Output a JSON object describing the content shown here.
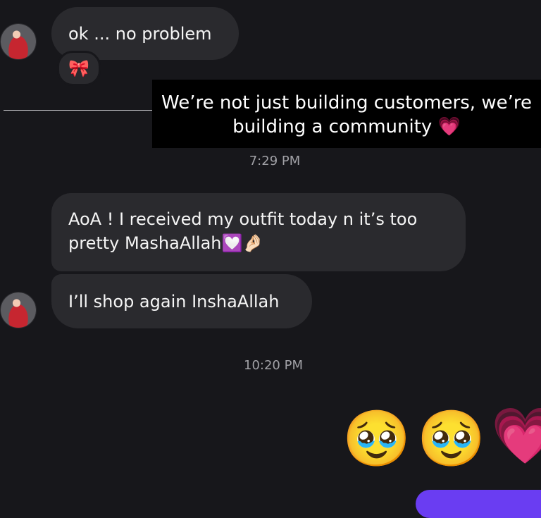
{
  "messages": {
    "first": "ok ... no problem",
    "first_reaction": "🎀",
    "story_text": "We’re not just building customers, we’re building a community 💗",
    "time_1": "7:29 PM",
    "second_line1": "AoA ! I received my outfit today n it’s too",
    "second_line2": "pretty MashaAllah💟🤌🏻",
    "third": "I’ll shop again InshaAllah",
    "time_2": "10:20 PM",
    "sent_emojis": [
      "🥹",
      "🥹",
      "💗"
    ]
  }
}
